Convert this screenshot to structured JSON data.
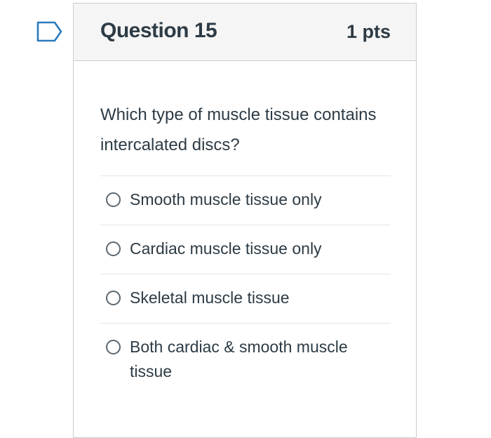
{
  "question": {
    "title": "Question 15",
    "points": "1 pts",
    "text": "Which type of muscle tissue contains intercalated discs?",
    "flag_icon": "flag-outline-icon"
  },
  "answers": [
    {
      "label": "Smooth muscle tissue only",
      "selected": false
    },
    {
      "label": "Cardiac muscle tissue only",
      "selected": false
    },
    {
      "label": "Skeletal muscle tissue",
      "selected": false
    },
    {
      "label": "Both cardiac & smooth muscle tissue",
      "selected": false
    }
  ],
  "colors": {
    "accent": "#2b7abc",
    "text": "#2d3b45",
    "header_bg": "#f5f5f5",
    "border": "#c7cdd1"
  }
}
